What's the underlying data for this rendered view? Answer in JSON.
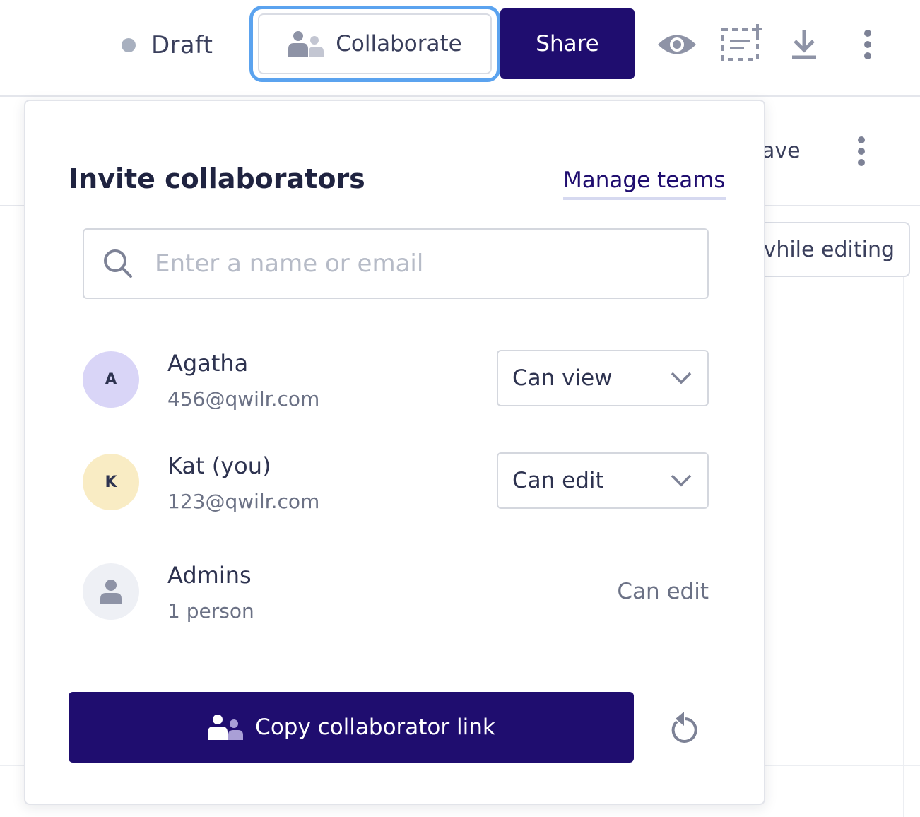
{
  "topbar": {
    "status_label": "Draft",
    "collaborate_label": "Collaborate",
    "share_label": "Share",
    "icons": [
      "eye-icon",
      "add-block-icon",
      "download-icon",
      "more-vertical-icon"
    ]
  },
  "background": {
    "save_label_partial": "ave",
    "editing_button_partial": "vhile editing"
  },
  "popover": {
    "title": "Invite collaborators",
    "manage_link": "Manage teams",
    "search": {
      "placeholder": "Enter a name or email",
      "value": ""
    },
    "collaborators": [
      {
        "initial": "A",
        "name": "Agatha",
        "sub": "456@qwilr.com",
        "permission": "Can view",
        "avatar_color": "#d9d5f7"
      },
      {
        "initial": "K",
        "name": "Kat (you)",
        "sub": "123@qwilr.com",
        "permission": "Can edit",
        "avatar_color": "#f9ecc4"
      },
      {
        "initial": "",
        "name": "Admins",
        "sub": "1 person",
        "permission": "Can edit",
        "avatar_color": "#eef0f5"
      }
    ],
    "copy_link_label": "Copy collaborator link"
  },
  "colors": {
    "brand": "#1f0d6f",
    "focus_ring": "#5ba3ef",
    "status_dot": "#a8b0bf"
  }
}
